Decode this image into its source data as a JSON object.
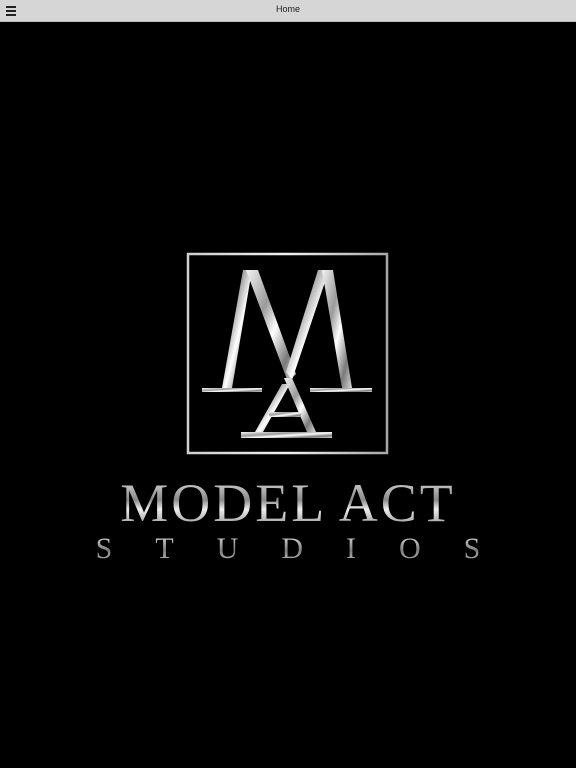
{
  "header": {
    "title": "Home",
    "menu_icon": "hamburger-menu-icon"
  },
  "logo": {
    "monogram": "MA",
    "name": "MODEL ACT",
    "tagline": "STUDIOS"
  },
  "colors": {
    "header_background": "#d6d6d6",
    "page_background": "#000000",
    "logo_silver": "#c8c8c8"
  }
}
